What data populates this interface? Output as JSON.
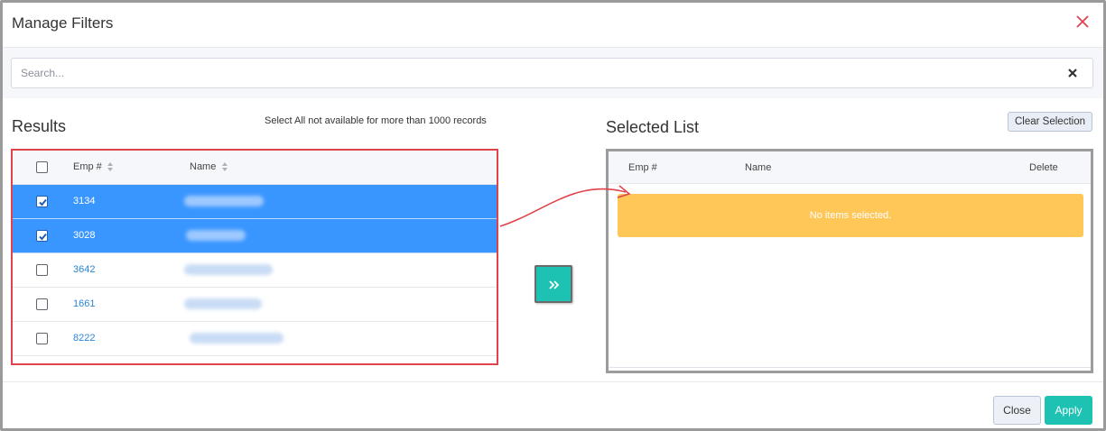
{
  "dialog": {
    "title": "Manage Filters"
  },
  "search": {
    "placeholder": "Search...",
    "value": ""
  },
  "results": {
    "title": "Results",
    "note": "Select All not available for more than 1000 records",
    "columns": [
      "Emp #",
      "Name"
    ],
    "rows": [
      {
        "emp": "3134",
        "selected": true
      },
      {
        "emp": "3028",
        "selected": true
      },
      {
        "emp": "3642",
        "selected": false
      },
      {
        "emp": "1661",
        "selected": false
      },
      {
        "emp": "8222",
        "selected": false
      }
    ]
  },
  "selected_list": {
    "title": "Selected List",
    "clear_label": "Clear Selection",
    "columns": [
      "Emp #",
      "Name",
      "Delete"
    ],
    "empty_message": "No items selected."
  },
  "footer": {
    "close_label": "Close",
    "apply_label": "Apply"
  },
  "colors": {
    "accent_teal": "#1ec2b3",
    "selected_row_blue": "#3a96ff",
    "empty_warning": "#ffc658",
    "annotation_red": "#e0434b"
  },
  "icons": {
    "dialog_close": "close-icon",
    "search_clear": "clear-icon",
    "move": "double-chevron-right-icon",
    "sort": "sort-icon",
    "check": "check-icon"
  }
}
